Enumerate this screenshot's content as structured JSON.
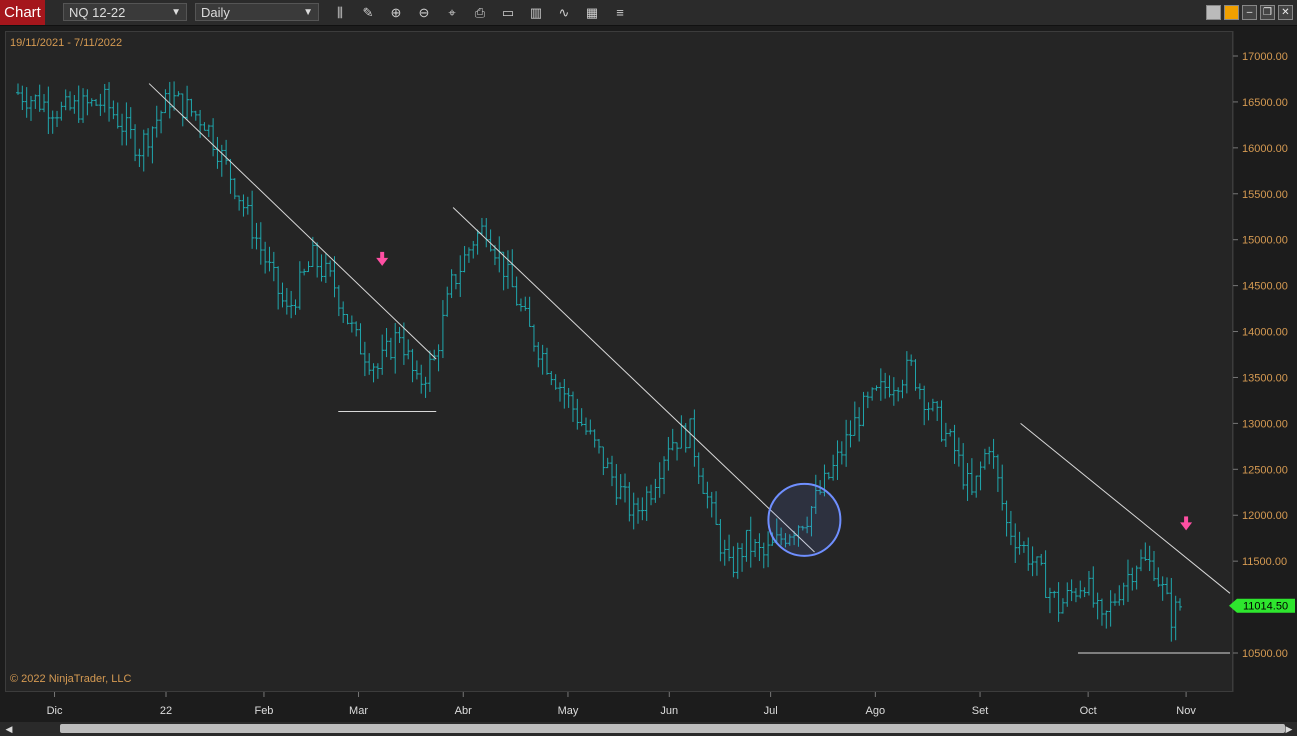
{
  "toolbar": {
    "chart_tab": "Chart",
    "instrument": "NQ 12-22",
    "timeframe": "Daily",
    "icons": [
      "bar-type-icon",
      "draw-pencil-icon",
      "zoom-in-icon",
      "zoom-out-icon",
      "crosshair-icon",
      "properties-icon",
      "data-box-icon",
      "bar-chart-icon",
      "indicator-icon",
      "strategy-icon",
      "menu-list-icon"
    ],
    "window_buttons": [
      "tile-icon",
      "color-icon",
      "minimize-icon",
      "restore-icon",
      "close-icon"
    ],
    "accent_color": "#a5161c"
  },
  "chart_header": {
    "date_range": "19/11/2021 - 7/11/2022"
  },
  "footer": {
    "copyright": "© 2022 NinjaTrader, LLC"
  },
  "chart_data": {
    "type": "bar",
    "bar_color": "#1fa7ad",
    "y_ticks": [
      17000,
      16500,
      16000,
      15500,
      15000,
      14500,
      14000,
      13500,
      13000,
      12500,
      12000,
      11500,
      10500
    ],
    "y_tick_labels": [
      "17000.00",
      "16500.00",
      "16000.00",
      "15500.00",
      "15000.00",
      "14500.00",
      "14000.00",
      "13500.00",
      "13000.00",
      "12500.00",
      "12000.00",
      "11500.00",
      "10500.00"
    ],
    "ylim": [
      10100,
      17400
    ],
    "x_labels": [
      "Dic",
      "22",
      "Feb",
      "Mar",
      "Abr",
      "May",
      "Jun",
      "Jul",
      "Ago",
      "Set",
      "Oct",
      "Nov"
    ],
    "current_price": "11014.50",
    "current_price_color": "#2ee62e",
    "price_keypoints": [
      [
        0,
        16600
      ],
      [
        10,
        16400
      ],
      [
        20,
        16500
      ],
      [
        28,
        16000
      ],
      [
        35,
        16550
      ],
      [
        43,
        16300
      ],
      [
        50,
        15600
      ],
      [
        56,
        14900
      ],
      [
        62,
        14200
      ],
      [
        68,
        14800
      ],
      [
        73,
        14500
      ],
      [
        78,
        13900
      ],
      [
        83,
        13600
      ],
      [
        88,
        14000
      ],
      [
        92,
        13400
      ],
      [
        96,
        13700
      ],
      [
        100,
        14500
      ],
      [
        105,
        15000
      ],
      [
        108,
        15150
      ],
      [
        112,
        14700
      ],
      [
        118,
        14000
      ],
      [
        124,
        13500
      ],
      [
        130,
        13000
      ],
      [
        136,
        12500
      ],
      [
        142,
        12000
      ],
      [
        146,
        12300
      ],
      [
        150,
        12800
      ],
      [
        155,
        12900
      ],
      [
        160,
        12000
      ],
      [
        164,
        11400
      ],
      [
        168,
        11700
      ],
      [
        172,
        11550
      ],
      [
        177,
        11800
      ],
      [
        182,
        12000
      ],
      [
        188,
        12500
      ],
      [
        194,
        13100
      ],
      [
        200,
        13400
      ],
      [
        206,
        13600
      ],
      [
        210,
        13200
      ],
      [
        216,
        12700
      ],
      [
        220,
        12200
      ],
      [
        224,
        12800
      ],
      [
        228,
        11900
      ],
      [
        234,
        11500
      ],
      [
        240,
        11000
      ],
      [
        246,
        11300
      ],
      [
        250,
        10800
      ],
      [
        254,
        11200
      ],
      [
        258,
        11500
      ],
      [
        262,
        11450
      ],
      [
        266,
        10900
      ],
      [
        268,
        11014.5
      ]
    ],
    "trendlines": [
      {
        "from": [
          "2021-12-29",
          16700
        ],
        "to": [
          "2022-03-24",
          13700
        ]
      },
      {
        "from": [
          "2022-03-29",
          15350
        ],
        "to": [
          "2022-07-14",
          11600
        ]
      },
      {
        "from": [
          "2022-09-13",
          13000
        ],
        "to": [
          "2022-11-14",
          11150
        ]
      }
    ],
    "support_lines": [
      {
        "from": [
          "2022-02-23",
          13130
        ],
        "to": [
          "2022-03-24",
          13130
        ]
      },
      {
        "from": [
          "2022-09-30",
          10500
        ],
        "to": [
          "2022-11-14",
          10500
        ]
      }
    ],
    "arrows": [
      {
        "date": "2022-03-08",
        "price": 14780,
        "color": "#ff4fa3"
      },
      {
        "date": "2022-11-01",
        "price": 11900,
        "color": "#ff4fa3"
      }
    ],
    "circle": {
      "date": "2022-07-11",
      "price": 11950,
      "color": "#6f8fff"
    }
  }
}
